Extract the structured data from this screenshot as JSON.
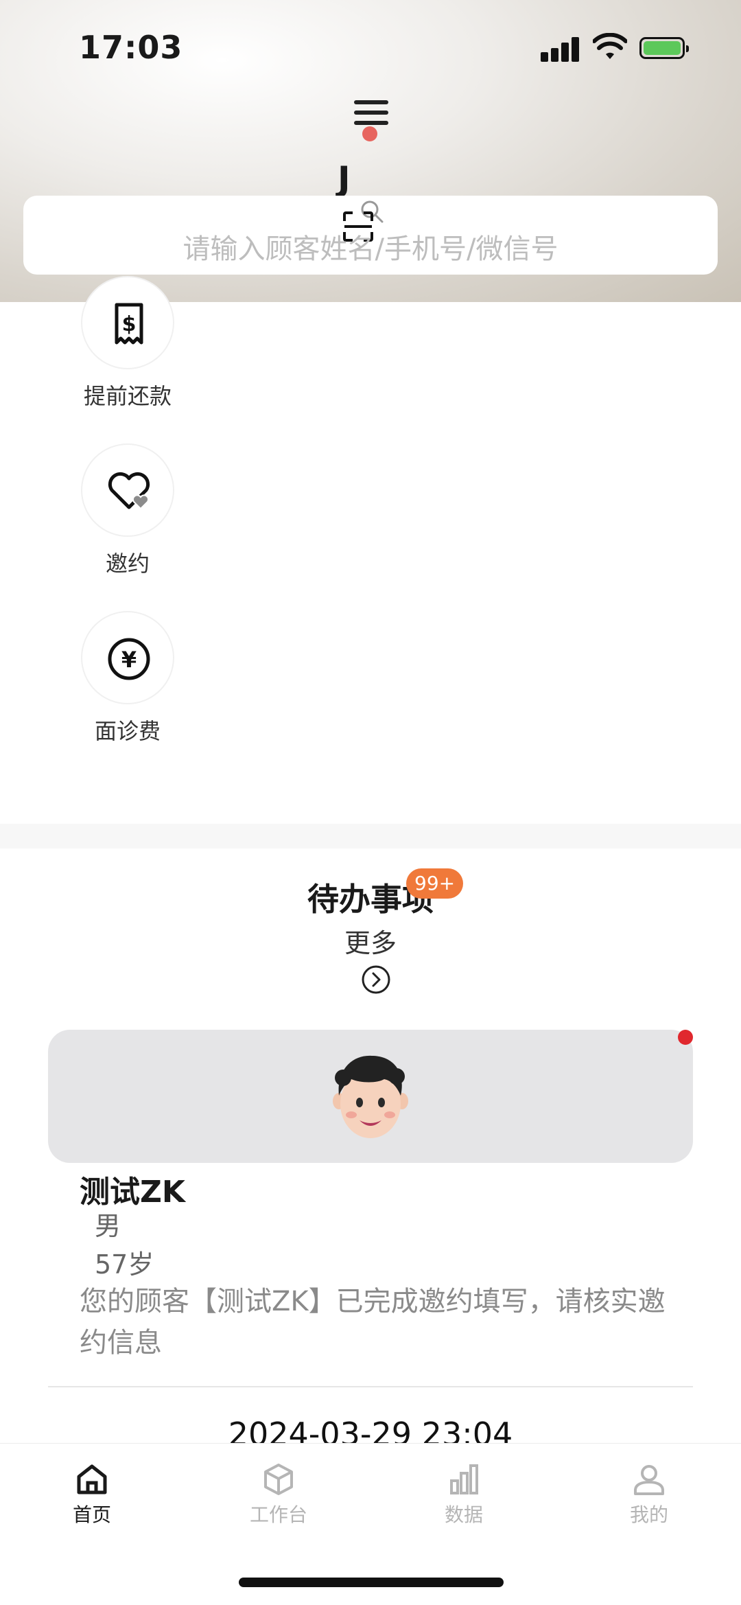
{
  "status_bar": {
    "time": "17:03",
    "battery_color": "#5cc85a"
  },
  "header": {
    "store_letter": "J",
    "search_placeholder": "请输入顾客姓名/手机号/微信号",
    "menu_icon": "hamburger-menu-icon",
    "notification_dot_color": "#e7655f"
  },
  "quick_actions": [
    {
      "label": "提前还款",
      "icon": "receipt-dollar-icon"
    },
    {
      "label": "邀约",
      "icon": "heart-icon"
    },
    {
      "label": "面诊费",
      "icon": "yen-coin-icon"
    }
  ],
  "todo": {
    "title": "待办事项",
    "badge": "99+",
    "badge_color": "#f0793a",
    "more_label": "更多"
  },
  "customer": {
    "name": "测试ZK",
    "gender": "男",
    "age": "57岁",
    "message": "您的顾客【测试ZK】已完成邀约填写，请核实邀约信息",
    "datetime": "2024-03-29 23:04"
  },
  "tab_bar": {
    "active_color": "#1a1a1a",
    "inactive_color": "#b5b5b5",
    "tabs": [
      {
        "label": "首页",
        "icon": "home-icon",
        "active": true
      },
      {
        "label": "工作台",
        "icon": "cube-icon",
        "active": false
      },
      {
        "label": "数据",
        "icon": "bar-chart-icon",
        "active": false
      },
      {
        "label": "我的",
        "icon": "person-icon",
        "active": false
      }
    ]
  }
}
